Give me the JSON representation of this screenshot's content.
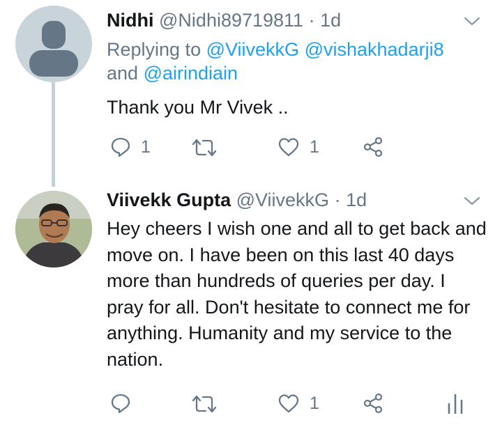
{
  "tweets": [
    {
      "author_name": "Nidhi",
      "handle": "@Nidhi89719811",
      "separator": "·",
      "time": "1d",
      "replying_prefix": "Replying to",
      "mention_1": "@ViivekkG",
      "mention_2": "@vishakhadarji8",
      "mention_joiner": "and",
      "mention_3": "@airindiain",
      "text": "Thank you Mr Vivek ..",
      "reply_count": "1",
      "retweet_count": "",
      "like_count": "1"
    },
    {
      "author_name": "Viivekk Gupta",
      "handle": "@ViivekkG",
      "separator": "·",
      "time": "1d",
      "text": "Hey cheers I wish one and all to get back and move on. I have been on this last 40 days more than hundreds of queries per day. I pray for all. Don't hesitate to connect me for anything. Humanity and my service to the nation.",
      "reply_count": "",
      "retweet_count": "",
      "like_count": "1"
    }
  ],
  "icons": {
    "reply": "reply-icon",
    "retweet": "retweet-icon",
    "like": "heart-icon",
    "share": "share-icon",
    "analytics": "analytics-icon",
    "menu": "chevron-down-icon"
  },
  "colors": {
    "link": "#1da1f2",
    "secondary_text": "#657786",
    "thread_line": "#c4cfd6"
  }
}
